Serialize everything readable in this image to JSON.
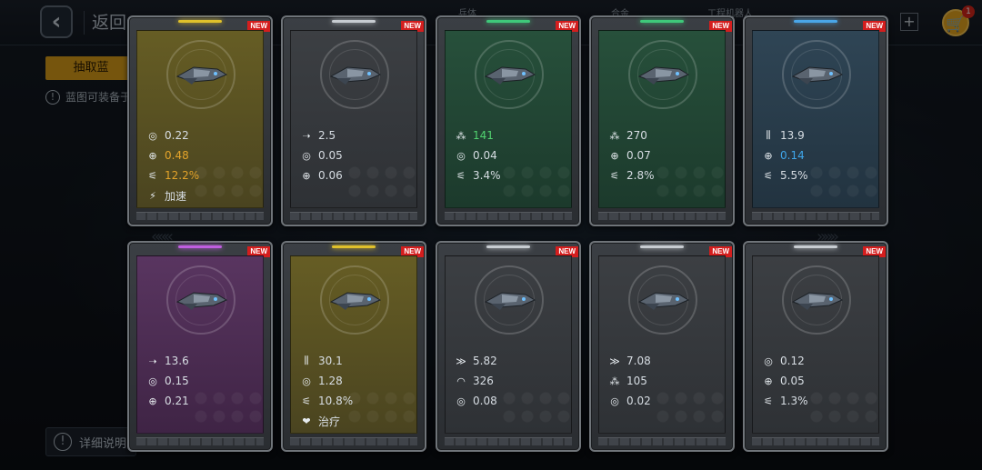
{
  "header": {
    "back_label": "返回",
    "hint_tabs": [
      "兵体",
      "合金",
      "工程机器人"
    ],
    "cart_badge": "1"
  },
  "sub_tab": {
    "label": "抽取蓝"
  },
  "info_text": "蓝图可装备于",
  "detail_label": "详细说明",
  "colors": {
    "yellow": "#e0c12b",
    "gray": "#c7ccd1",
    "green": "#3fc87a",
    "blue": "#4aa6e8",
    "purple": "#c05ee0",
    "new_tag": "#d41e1e",
    "orange_value": "#e3a32a",
    "green_value": "#51d26f",
    "blue_value": "#3fa6ea"
  },
  "cards": [
    {
      "tier": "yellow",
      "new": "NEW",
      "stats": [
        {
          "icon": "target-circle-icon",
          "value": "0.22",
          "hl": ""
        },
        {
          "icon": "crosshair-icon",
          "value": "0.48",
          "hl": "orange"
        },
        {
          "icon": "missile-icon",
          "value": "12.2%",
          "hl": "orange"
        },
        {
          "icon": "boost-icon",
          "value": "加速",
          "hl": ""
        }
      ]
    },
    {
      "tier": "gray",
      "new": "NEW",
      "stats": [
        {
          "icon": "arrow-right-icon",
          "value": "2.5",
          "hl": ""
        },
        {
          "icon": "target-circle-icon",
          "value": "0.05",
          "hl": ""
        },
        {
          "icon": "crosshair-icon",
          "value": "0.06",
          "hl": ""
        }
      ]
    },
    {
      "tier": "green",
      "new": "NEW",
      "stats": [
        {
          "icon": "cluster-icon",
          "value": "141",
          "hl": "green"
        },
        {
          "icon": "target-circle-icon",
          "value": "0.04",
          "hl": ""
        },
        {
          "icon": "missile-icon",
          "value": "3.4%",
          "hl": ""
        }
      ]
    },
    {
      "tier": "green",
      "new": "NEW",
      "stats": [
        {
          "icon": "cluster-icon",
          "value": "270",
          "hl": ""
        },
        {
          "icon": "crosshair-icon",
          "value": "0.07",
          "hl": ""
        },
        {
          "icon": "missile-icon",
          "value": "2.8%",
          "hl": ""
        }
      ]
    },
    {
      "tier": "blue",
      "new": "NEW",
      "stats": [
        {
          "icon": "ammo-icon",
          "value": "13.9",
          "hl": ""
        },
        {
          "icon": "crosshair-icon",
          "value": "0.14",
          "hl": "blue"
        },
        {
          "icon": "missile-icon",
          "value": "5.5%",
          "hl": ""
        }
      ]
    },
    {
      "tier": "purple",
      "new": "NEW",
      "stats": [
        {
          "icon": "arrow-right-icon",
          "value": "13.6",
          "hl": ""
        },
        {
          "icon": "target-circle-icon",
          "value": "0.15",
          "hl": ""
        },
        {
          "icon": "crosshair-icon",
          "value": "0.21",
          "hl": ""
        }
      ]
    },
    {
      "tier": "yellow",
      "new": "NEW",
      "stats": [
        {
          "icon": "ammo-icon",
          "value": "30.1",
          "hl": ""
        },
        {
          "icon": "target-circle-icon",
          "value": "1.28",
          "hl": ""
        },
        {
          "icon": "missile-icon",
          "value": "10.8%",
          "hl": ""
        },
        {
          "icon": "heal-icon",
          "value": "治疗",
          "hl": ""
        }
      ]
    },
    {
      "tier": "gray",
      "new": "NEW",
      "stats": [
        {
          "icon": "speed-icon",
          "value": "5.82",
          "hl": ""
        },
        {
          "icon": "shield-arc-icon",
          "value": "326",
          "hl": ""
        },
        {
          "icon": "target-circle-icon",
          "value": "0.08",
          "hl": ""
        }
      ]
    },
    {
      "tier": "gray",
      "new": "NEW",
      "stats": [
        {
          "icon": "speed-icon",
          "value": "7.08",
          "hl": ""
        },
        {
          "icon": "cluster-icon",
          "value": "105",
          "hl": ""
        },
        {
          "icon": "target-circle-icon",
          "value": "0.02",
          "hl": ""
        }
      ]
    },
    {
      "tier": "gray",
      "new": "NEW",
      "stats": [
        {
          "icon": "target-circle-icon",
          "value": "0.12",
          "hl": ""
        },
        {
          "icon": "crosshair-icon",
          "value": "0.05",
          "hl": ""
        },
        {
          "icon": "missile-icon",
          "value": "1.3%",
          "hl": ""
        }
      ]
    }
  ]
}
